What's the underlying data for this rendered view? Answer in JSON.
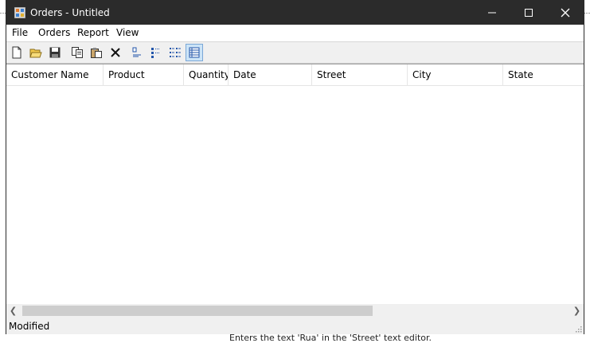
{
  "window": {
    "title": "Orders - Untitled"
  },
  "menu": [
    "File",
    "Orders",
    "Report",
    "View"
  ],
  "toolbar": [
    {
      "icon": "new-file-icon"
    },
    {
      "icon": "open-folder-icon"
    },
    {
      "icon": "save-icon"
    },
    {
      "icon": "copy-icon"
    },
    {
      "icon": "paste-icon"
    },
    {
      "icon": "delete-icon"
    },
    {
      "icon": "large-icons-view-icon"
    },
    {
      "icon": "small-icons-view-icon"
    },
    {
      "icon": "list-view-icon"
    },
    {
      "icon": "details-view-icon",
      "active": true
    }
  ],
  "columns": [
    "Customer Name",
    "Product",
    "Quantity",
    "Date",
    "Street",
    "City",
    "State"
  ],
  "status": "Modified",
  "caption": "Enters the text 'Rua' in the 'Street' text editor."
}
